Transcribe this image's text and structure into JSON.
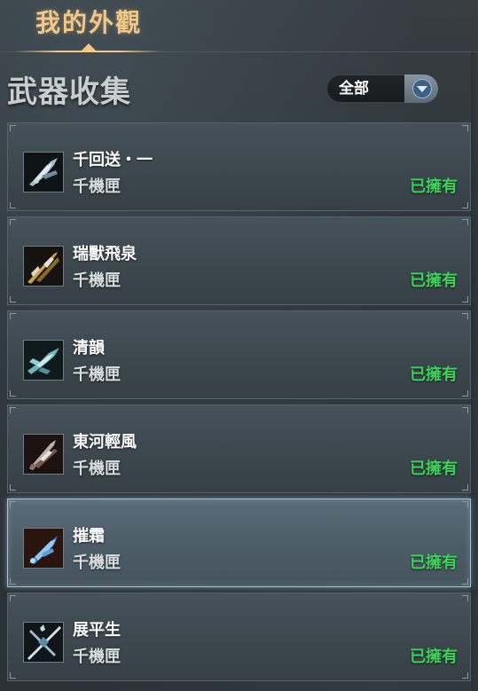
{
  "tabs": [
    {
      "label": "我的外觀",
      "active": true
    }
  ],
  "section": {
    "title": "武器收集"
  },
  "filter": {
    "selected": "全部",
    "icon": "chevron-down-icon"
  },
  "colors": {
    "tab_active": "#f1c88a",
    "status_owned": "#3bd35a",
    "selected_border": "#a9c0cf"
  },
  "weapons": [
    {
      "name": "千回送・一",
      "category": "千機匣",
      "status": "已擁有",
      "icon": "weapon-thumbnail",
      "selected": false
    },
    {
      "name": "瑞獸飛泉",
      "category": "千機匣",
      "status": "已擁有",
      "icon": "weapon-thumbnail",
      "selected": false
    },
    {
      "name": "清韻",
      "category": "千機匣",
      "status": "已擁有",
      "icon": "weapon-thumbnail",
      "selected": false
    },
    {
      "name": "東河輕風",
      "category": "千機匣",
      "status": "已擁有",
      "icon": "weapon-thumbnail",
      "selected": false
    },
    {
      "name": "摧霜",
      "category": "千機匣",
      "status": "已擁有",
      "icon": "weapon-thumbnail",
      "selected": true
    },
    {
      "name": "展平生",
      "category": "千機匣",
      "status": "已擁有",
      "icon": "weapon-thumbnail",
      "selected": false
    }
  ]
}
